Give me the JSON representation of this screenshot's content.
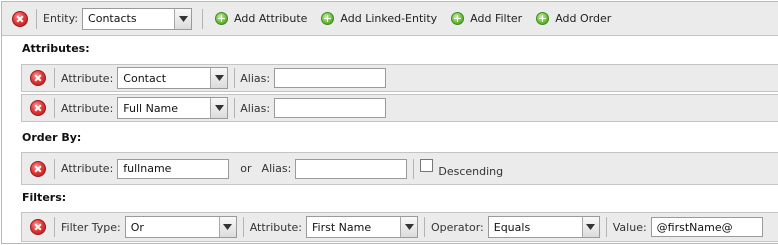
{
  "toolbar": {
    "entity_label": "Entity:",
    "entity_value": "Contacts",
    "add_attribute": "Add Attribute",
    "add_linked_entity": "Add Linked-Entity",
    "add_filter": "Add Filter",
    "add_order": "Add Order"
  },
  "attributes": {
    "heading": "Attributes:",
    "rows": [
      {
        "attribute_label": "Attribute:",
        "attribute_value": "Contact",
        "alias_label": "Alias:",
        "alias_value": ""
      },
      {
        "attribute_label": "Attribute:",
        "attribute_value": "Full Name",
        "alias_label": "Alias:",
        "alias_value": ""
      }
    ]
  },
  "order_by": {
    "heading": "Order By:",
    "attribute_label": "Attribute:",
    "attribute_value": "fullname",
    "or_text": "or",
    "alias_label": "Alias:",
    "alias_value": "",
    "descending_label": "Descending",
    "descending_checked": false
  },
  "filters": {
    "heading": "Filters:",
    "filter_type_label": "Filter Type:",
    "filter_type_value": "Or",
    "attribute_label": "Attribute:",
    "attribute_value": "First Name",
    "operator_label": "Operator:",
    "operator_value": "Equals",
    "value_label": "Value:",
    "value_value": "@firstName@"
  },
  "icons": {
    "delete": "delete-icon",
    "add": "add-icon",
    "dropdown": "chevron-down-icon"
  },
  "colors": {
    "bar_background": "#ebebeb",
    "delete_red": "#e03c3c",
    "add_green": "#6fbf3b"
  }
}
